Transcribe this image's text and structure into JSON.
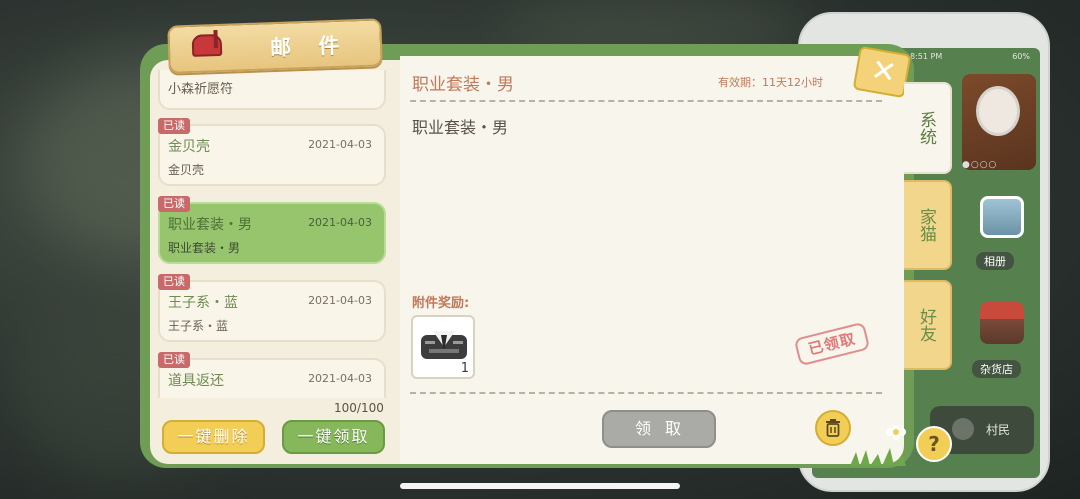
{
  "phone": {
    "status_time": "8:51 PM",
    "status_battery": "60%",
    "apps": [
      {
        "label": "相册",
        "icon": "photo-album-icon"
      },
      {
        "label": "杂货店",
        "icon": "shop-icon"
      }
    ],
    "villager_label": "村民"
  },
  "mail": {
    "title": "邮 件",
    "list": [
      {
        "read_tag": "",
        "subject": "小森祈愿符",
        "date": "",
        "preview": "",
        "partial": true
      },
      {
        "read_tag": "已读",
        "subject": "金贝壳",
        "date": "2021-04-03",
        "preview": "金贝壳"
      },
      {
        "read_tag": "已读",
        "subject": "职业套装・男",
        "date": "2021-04-03",
        "preview": "职业套装・男",
        "selected": true
      },
      {
        "read_tag": "已读",
        "subject": "王子系・蓝",
        "date": "2021-04-03",
        "preview": "王子系・蓝"
      },
      {
        "read_tag": "已读",
        "subject": "道具返还",
        "date": "2021-04-03",
        "preview": ""
      }
    ],
    "count": "100/100",
    "delete_all_label": "一键删除",
    "claim_all_label": "一键领取"
  },
  "detail": {
    "title": "职业套装・男",
    "expiry": "有效期：11天12小时",
    "body": "职业套装・男",
    "attachments_label": "附件奖励:",
    "attachment_qty": "1",
    "attachment_icon": "suit-icon",
    "claimed_stamp": "已领取",
    "claim_label": "领取"
  },
  "tabs": [
    {
      "label": "系统",
      "active": true
    },
    {
      "label": "家猫",
      "active": false
    },
    {
      "label": "好友",
      "active": false
    }
  ],
  "help_label": "?",
  "colors": {
    "dialog_green": "#6f9d56",
    "selected_green": "#97c56e",
    "accent_yellow": "#f3ce57",
    "text_orange": "#c07a5a"
  }
}
